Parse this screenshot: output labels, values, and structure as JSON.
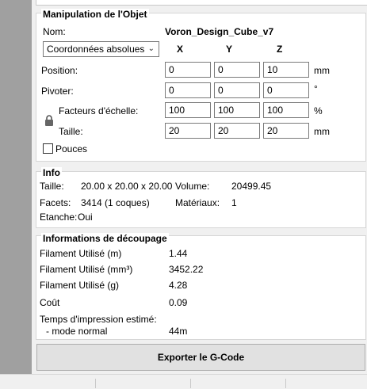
{
  "manipulation": {
    "title": "Manipulation de l'Objet",
    "name_label": "Nom:",
    "name_value": "Voron_Design_Cube_v7",
    "coord_select": "Coordonnées absolues",
    "axis_x": "X",
    "axis_y": "Y",
    "axis_z": "Z",
    "position_label": "Position:",
    "position": {
      "x": "0",
      "y": "0",
      "z": "10"
    },
    "position_unit": "mm",
    "rotate_label": "Pivoter:",
    "rotate": {
      "x": "0",
      "y": "0",
      "z": "0"
    },
    "rotate_unit": "°",
    "scale_label": "Facteurs d'échelle:",
    "scale": {
      "x": "100",
      "y": "100",
      "z": "100"
    },
    "scale_unit": "%",
    "size_label": "Taille:",
    "size": {
      "x": "20",
      "y": "20",
      "z": "20"
    },
    "size_unit": "mm",
    "inches_label": "Pouces"
  },
  "info": {
    "title": "Info",
    "size_label": "Taille:",
    "size_value": "20.00 x 20.00 x 20.00",
    "volume_label": "Volume:",
    "volume_value": "20499.45",
    "facets_label": "Facets:",
    "facets_value": "3414 (1 coques)",
    "materials_label": "Matériaux:",
    "materials_value": "1",
    "manifold_label": "Etanche:",
    "manifold_value": "Oui"
  },
  "slicing": {
    "title": "Informations de découpage",
    "filament_m_label": "Filament Utilisé (m)",
    "filament_m_value": "1.44",
    "filament_mm3_label": "Filament Utilisé (mm³)",
    "filament_mm3_value": "3452.22",
    "filament_g_label": "Filament Utilisé (g)",
    "filament_g_value": "4.28",
    "cost_label": "Coût",
    "cost_value": "0.09",
    "time_label": "Temps d'impression estimé:",
    "mode_label": "- mode normal",
    "mode_value": "44m"
  },
  "export_button": "Exporter le G-Code"
}
